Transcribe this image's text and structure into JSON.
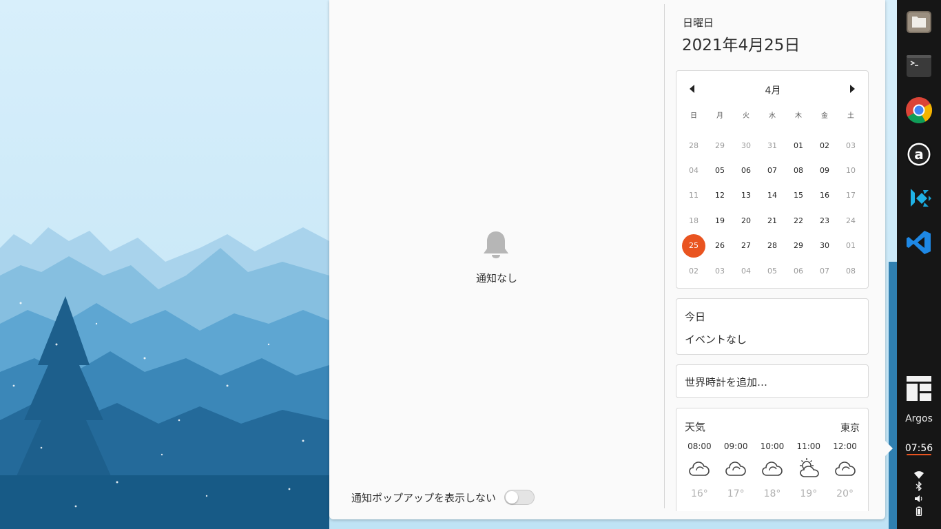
{
  "notifications": {
    "empty_label": "通知なし",
    "dnd_label": "通知ポップアップを表示しない",
    "dnd_enabled": false
  },
  "date_header": {
    "day_name": "日曜日",
    "full_date": "2021年4月25日"
  },
  "calendar": {
    "month_label": "4月",
    "weekdays": [
      "日",
      "月",
      "火",
      "水",
      "木",
      "金",
      "土"
    ],
    "weeks": [
      [
        "28",
        "29",
        "30",
        "31",
        "01",
        "02",
        "03"
      ],
      [
        "04",
        "05",
        "06",
        "07",
        "08",
        "09",
        "10"
      ],
      [
        "11",
        "12",
        "13",
        "14",
        "15",
        "16",
        "17"
      ],
      [
        "18",
        "19",
        "20",
        "21",
        "22",
        "23",
        "24"
      ],
      [
        "25",
        "26",
        "27",
        "28",
        "29",
        "30",
        "01"
      ],
      [
        "02",
        "03",
        "04",
        "05",
        "06",
        "07",
        "08"
      ]
    ],
    "today": "25",
    "accent_color": "#e95420"
  },
  "events": {
    "title": "今日",
    "empty_label": "イベントなし"
  },
  "world_clocks": {
    "add_label": "世界時計を追加…"
  },
  "weather": {
    "title": "天気",
    "city": "東京",
    "forecast": [
      {
        "time": "08:00",
        "icon": "cloudy-icon",
        "temp": "16°"
      },
      {
        "time": "09:00",
        "icon": "cloudy-icon",
        "temp": "17°"
      },
      {
        "time": "10:00",
        "icon": "cloudy-icon",
        "temp": "18°"
      },
      {
        "time": "11:00",
        "icon": "partly-cloudy-icon",
        "temp": "19°"
      },
      {
        "time": "12:00",
        "icon": "cloudy-icon",
        "temp": "20°"
      }
    ]
  },
  "dock": {
    "apps": [
      {
        "name": "files",
        "icon": "folder-icon"
      },
      {
        "name": "terminal",
        "icon": "terminal-icon"
      },
      {
        "name": "chrome",
        "icon": "chrome-icon"
      },
      {
        "name": "amazon",
        "icon": "amazon-icon"
      },
      {
        "name": "kodi",
        "icon": "kodi-icon"
      },
      {
        "name": "vscode",
        "icon": "vscode-icon"
      }
    ],
    "extension_label": "Argos",
    "clock": "07:56",
    "tray_icons": [
      "wifi-icon",
      "bluetooth-icon",
      "volume-icon",
      "battery-icon"
    ]
  }
}
